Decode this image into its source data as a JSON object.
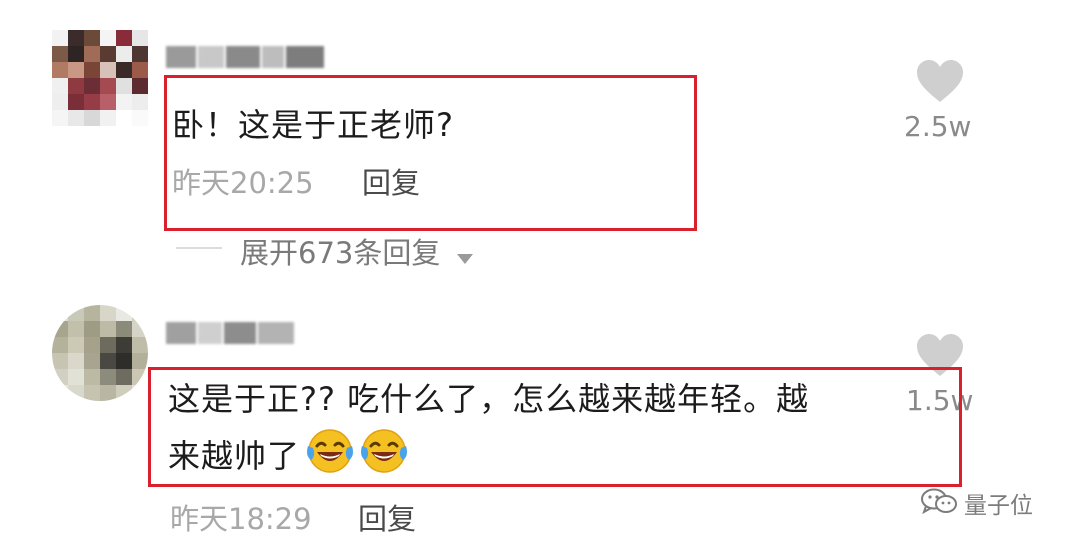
{
  "comments": [
    {
      "text": "卧！这是于正老师?",
      "time": "昨天20:25",
      "reply_label": "回复",
      "like_count": "2.5w",
      "expand_label": "展开673条回复"
    },
    {
      "text_line1": "这是于正?? 吃什么了，怎么越来越年轻。越",
      "text_line2": "来越帅了",
      "emojis": [
        "laughing-crying-emoji",
        "laughing-crying-emoji"
      ],
      "time": "昨天18:29",
      "reply_label": "回复",
      "like_count": "1.5w"
    }
  ],
  "watermark": {
    "icon": "wechat-icon",
    "label": "量子位"
  },
  "colors": {
    "highlight_box": "#d9202c",
    "heart": "#cfcfcf",
    "time_text": "#a8a8a8"
  }
}
